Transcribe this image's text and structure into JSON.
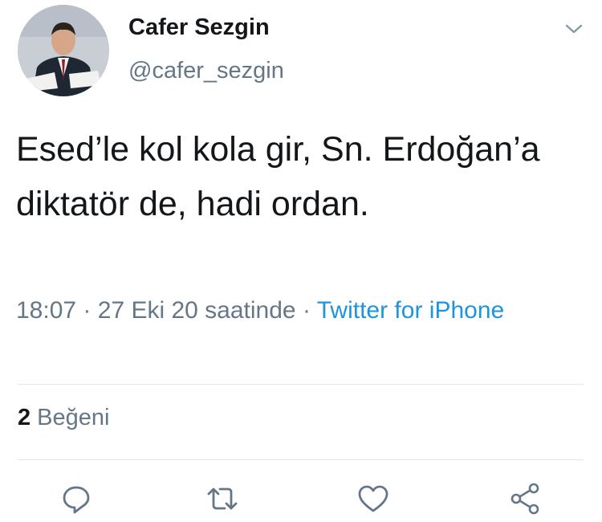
{
  "author": {
    "name": "Cafer Sezgin",
    "handle": "@cafer_sezgin",
    "avatar": "profile-photo"
  },
  "tweet": {
    "text": "Esed’le kol kola gir, Sn. Erdoğan’a diktatör de, hadi ordan.",
    "time": "18:07",
    "separator": "·",
    "date": "27 Eki 20 saatinde",
    "source": "Twitter for iPhone"
  },
  "stats": {
    "likes_count": "2",
    "likes_label": "Beğeni"
  },
  "actions": [
    "reply-icon",
    "retweet-icon",
    "like-icon",
    "share-icon"
  ],
  "colors": {
    "text": "#14171a",
    "secondary": "#657786",
    "link": "#1b95e0",
    "divider": "#e1e8ed"
  }
}
